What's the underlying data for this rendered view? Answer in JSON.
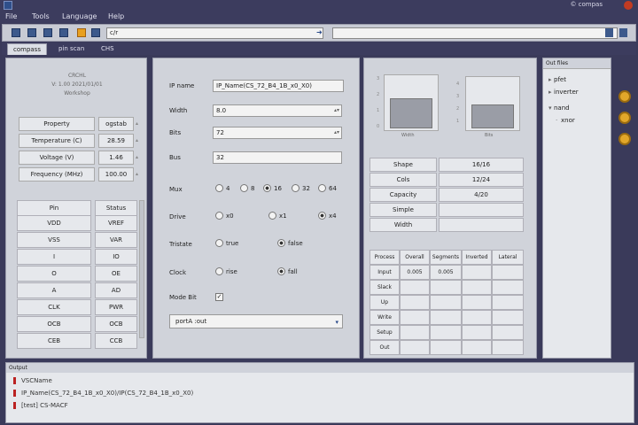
{
  "window": {
    "title_right": "© compas"
  },
  "menu": [
    "File",
    "Tools",
    "Language",
    "Help"
  ],
  "toolbar": {
    "path": "c/r"
  },
  "tabs": [
    {
      "label": "compass",
      "active": true
    },
    {
      "label": "pin scan",
      "active": false
    },
    {
      "label": "CHS",
      "active": false
    }
  ],
  "left": {
    "info": [
      "CRCHL",
      "V: 1.00 2021/01/01",
      "Workshop"
    ],
    "params": [
      {
        "label": "Property",
        "value": "ogstab"
      },
      {
        "label": "Temperature (C)",
        "value": "28.59"
      },
      {
        "label": "Voltage (V)",
        "value": "1.46"
      },
      {
        "label": "Frequency (MHz)",
        "value": "100.00"
      }
    ],
    "pin_headers": [
      "Pin",
      "Status"
    ],
    "pins": [
      [
        "VDD",
        "VREF"
      ],
      [
        "VSS",
        "VAR"
      ],
      [
        "I",
        "IO"
      ],
      [
        "O",
        "OE"
      ],
      [
        "A",
        "AD"
      ],
      [
        "CLK",
        "PWR"
      ],
      [
        "OCB",
        "OCB"
      ],
      [
        "CEB",
        "CCB"
      ]
    ]
  },
  "center": {
    "fields": [
      {
        "label": "IP name",
        "value": "IP_Name(CS_72_B4_1B_x0_X0)",
        "has_arrow": false
      },
      {
        "label": "Width",
        "value": "8.0",
        "has_arrow": true
      },
      {
        "label": "Bits",
        "value": "72",
        "has_arrow": true
      },
      {
        "label": "Bus",
        "value": "32",
        "has_arrow": false
      }
    ],
    "mux": {
      "label": "Mux",
      "options": [
        "4",
        "8",
        "16",
        "32",
        "64"
      ]
    },
    "drive": {
      "label": "Drive",
      "options": [
        "x0",
        "x1",
        "x4"
      ]
    },
    "tristate": {
      "label": "Tristate",
      "options": [
        "true",
        "false"
      ]
    },
    "clock": {
      "label": "Clock",
      "options": [
        "rise",
        "fall"
      ]
    },
    "mode_bit": {
      "label": "Mode Bit",
      "checked": true
    },
    "port": "portA :out"
  },
  "right": {
    "chart1": {
      "caption": "Width",
      "fill_fraction": 0.55,
      "y_ticks": [
        "3",
        "2",
        "1",
        "0"
      ]
    },
    "chart2": {
      "caption": "Bits",
      "fill_fraction": 0.45,
      "y_ticks": [
        "4",
        "3",
        "2",
        "1"
      ]
    },
    "stats": [
      {
        "label": "Shape",
        "value": "16/16"
      },
      {
        "label": "Cols",
        "value": "12/24"
      },
      {
        "label": "Capacity",
        "value": "4/20"
      },
      {
        "label": "Simple",
        "value": ""
      },
      {
        "label": "Width",
        "value": ""
      }
    ],
    "table_headers": [
      "Process",
      "Overall",
      "Segments",
      "Inverted",
      "Lateral"
    ],
    "table_rows": [
      [
        "Input",
        "0.005",
        "0.005",
        "",
        ""
      ],
      [
        "Slack",
        "",
        "",
        "",
        ""
      ],
      [
        "Up",
        "",
        "",
        "",
        ""
      ],
      [
        "Write",
        "",
        "",
        "",
        ""
      ],
      [
        "Setup",
        "",
        "",
        "",
        ""
      ],
      [
        "Out",
        "",
        "",
        "",
        ""
      ]
    ]
  },
  "tree": {
    "header": "Out files",
    "items": [
      "pfet",
      "inverter",
      "nand",
      "xnor"
    ]
  },
  "log": {
    "header": "Output",
    "lines": [
      "VSCName",
      "IP_Name(CS_72_B4_1B_x0_X0)/IP(CS_72_B4_1B_x0_X0)",
      "[test] CS-MACF"
    ]
  },
  "colors": {
    "accent": "#3d5a8c",
    "title_bg": "#3c3c5e",
    "panel_bg": "#d0d3da",
    "warn": "#e8a020"
  }
}
